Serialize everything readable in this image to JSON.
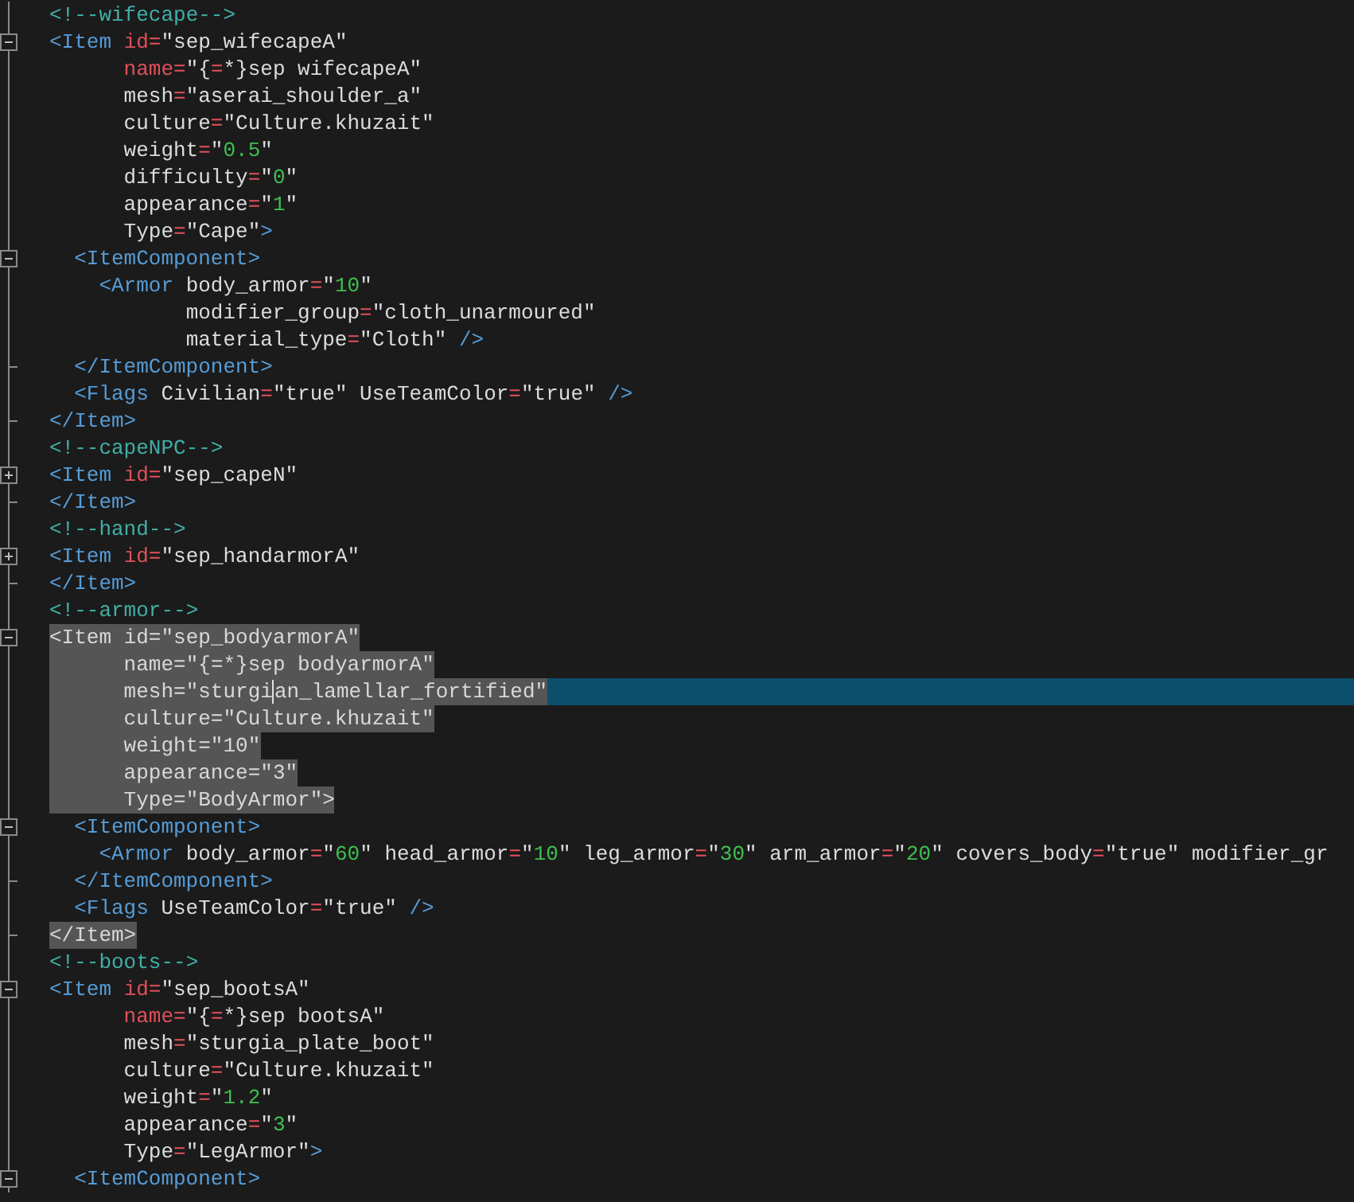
{
  "editor": {
    "lines": [
      {
        "kind": "top",
        "selected": false,
        "tokens": [
          {
            "kind": "comment",
            "text": "<!--wifecape-->"
          }
        ]
      },
      {
        "kind": "top",
        "selected": false,
        "fold_box": {
          "collapsed": false
        },
        "tokens": [
          {
            "kind": "tag",
            "text": "<Item"
          },
          {
            "kind": "attr",
            "text": " id"
          },
          {
            "kind": "eq",
            "text": "="
          },
          {
            "kind": "text",
            "text": "\"sep_wifecapeA\""
          }
        ]
      },
      {
        "kind": "attr",
        "selected": false,
        "tokens": [
          {
            "kind": "attr",
            "text": "name"
          },
          {
            "kind": "eq",
            "text": "="
          },
          {
            "kind": "text",
            "text": "\"{"
          },
          {
            "kind": "eq",
            "text": "="
          },
          {
            "kind": "text",
            "text": "*}sep wifecapeA\""
          }
        ]
      },
      {
        "kind": "attr",
        "selected": false,
        "tokens": [
          {
            "kind": "text",
            "text": "mesh"
          },
          {
            "kind": "eq",
            "text": "="
          },
          {
            "kind": "text",
            "text": "\"aserai_shoulder_a\""
          }
        ]
      },
      {
        "kind": "attr",
        "selected": false,
        "tokens": [
          {
            "kind": "text",
            "text": "culture"
          },
          {
            "kind": "eq",
            "text": "="
          },
          {
            "kind": "text",
            "text": "\"Culture.khuzait\""
          }
        ]
      },
      {
        "kind": "attr",
        "selected": false,
        "tokens": [
          {
            "kind": "text",
            "text": "weight"
          },
          {
            "kind": "eq",
            "text": "="
          },
          {
            "kind": "text",
            "text": "\""
          },
          {
            "kind": "num",
            "text": "0.5"
          },
          {
            "kind": "text",
            "text": "\""
          }
        ]
      },
      {
        "kind": "attr",
        "selected": false,
        "tokens": [
          {
            "kind": "text",
            "text": "difficulty"
          },
          {
            "kind": "eq",
            "text": "="
          },
          {
            "kind": "text",
            "text": "\""
          },
          {
            "kind": "num",
            "text": "0"
          },
          {
            "kind": "text",
            "text": "\""
          }
        ]
      },
      {
        "kind": "attr",
        "selected": false,
        "tokens": [
          {
            "kind": "text",
            "text": "appearance"
          },
          {
            "kind": "eq",
            "text": "="
          },
          {
            "kind": "text",
            "text": "\""
          },
          {
            "kind": "num",
            "text": "1"
          },
          {
            "kind": "text",
            "text": "\""
          }
        ]
      },
      {
        "kind": "attr",
        "selected": false,
        "tokens": [
          {
            "kind": "text",
            "text": "Type"
          },
          {
            "kind": "eq",
            "text": "="
          },
          {
            "kind": "text",
            "text": "\"Cape\""
          },
          {
            "kind": "tag",
            "text": ">"
          }
        ]
      },
      {
        "kind": "child",
        "selected": false,
        "fold_box": {
          "collapsed": false
        },
        "tokens": [
          {
            "kind": "tag",
            "text": "<ItemComponent>"
          }
        ]
      },
      {
        "kind": "grandchild",
        "selected": false,
        "tokens": [
          {
            "kind": "tag",
            "text": "<Armor"
          },
          {
            "kind": "text",
            "text": " body_armor"
          },
          {
            "kind": "eq",
            "text": "="
          },
          {
            "kind": "text",
            "text": "\""
          },
          {
            "kind": "num",
            "text": "10"
          },
          {
            "kind": "text",
            "text": "\""
          }
        ]
      },
      {
        "kind": "attr2",
        "selected": false,
        "tokens": [
          {
            "kind": "text",
            "text": "modifier_group"
          },
          {
            "kind": "eq",
            "text": "="
          },
          {
            "kind": "text",
            "text": "\"cloth_unarmoured\""
          }
        ]
      },
      {
        "kind": "attr2",
        "selected": false,
        "tokens": [
          {
            "kind": "text",
            "text": "material_type"
          },
          {
            "kind": "eq",
            "text": "="
          },
          {
            "kind": "text",
            "text": "\"Cloth\""
          },
          {
            "kind": "tag",
            "text": " />"
          }
        ]
      },
      {
        "kind": "child",
        "selected": false,
        "block_end": true,
        "tokens": [
          {
            "kind": "tag",
            "text": "</ItemComponent>"
          }
        ]
      },
      {
        "kind": "child",
        "selected": false,
        "tokens": [
          {
            "kind": "tag",
            "text": "<Flags"
          },
          {
            "kind": "text",
            "text": " Civilian"
          },
          {
            "kind": "eq",
            "text": "="
          },
          {
            "kind": "text",
            "text": "\"true\""
          },
          {
            "kind": "text",
            "text": " UseTeamColor"
          },
          {
            "kind": "eq",
            "text": "="
          },
          {
            "kind": "text",
            "text": "\"true\""
          },
          {
            "kind": "tag",
            "text": " />"
          }
        ]
      },
      {
        "kind": "top",
        "selected": false,
        "block_end": true,
        "tokens": [
          {
            "kind": "tag",
            "text": "</Item>"
          }
        ]
      },
      {
        "kind": "top",
        "selected": false,
        "tokens": [
          {
            "kind": "comment",
            "text": "<!--capeNPC-->"
          }
        ]
      },
      {
        "kind": "top",
        "selected": false,
        "fold_box": {
          "collapsed": true
        },
        "tokens": [
          {
            "kind": "tag",
            "text": "<Item"
          },
          {
            "kind": "attr",
            "text": " id"
          },
          {
            "kind": "eq",
            "text": "="
          },
          {
            "kind": "text",
            "text": "\"sep_capeN\""
          }
        ]
      },
      {
        "kind": "top",
        "selected": false,
        "block_end": true,
        "tokens": [
          {
            "kind": "tag",
            "text": "</Item>"
          }
        ]
      },
      {
        "kind": "top",
        "selected": false,
        "tokens": [
          {
            "kind": "comment",
            "text": "<!--hand-->"
          }
        ]
      },
      {
        "kind": "top",
        "selected": false,
        "fold_box": {
          "collapsed": true
        },
        "tokens": [
          {
            "kind": "tag",
            "text": "<Item"
          },
          {
            "kind": "attr",
            "text": " id"
          },
          {
            "kind": "eq",
            "text": "="
          },
          {
            "kind": "text",
            "text": "\"sep_handarmorA\""
          }
        ]
      },
      {
        "kind": "top",
        "selected": false,
        "block_end": true,
        "tokens": [
          {
            "kind": "tag",
            "text": "</Item>"
          }
        ]
      },
      {
        "kind": "top",
        "selected": false,
        "tokens": [
          {
            "kind": "comment",
            "text": "<!--armor-->"
          }
        ]
      },
      {
        "kind": "top",
        "selected": true,
        "fold_box": {
          "collapsed": false
        },
        "tokens": [
          {
            "kind": "tag",
            "text": "<Item"
          },
          {
            "kind": "attr",
            "text": " id"
          },
          {
            "kind": "eq",
            "text": "="
          },
          {
            "kind": "text",
            "text": "\"sep_bodyarmorA\""
          }
        ]
      },
      {
        "kind": "attr",
        "selected": true,
        "tokens": [
          {
            "kind": "attr",
            "text": "name"
          },
          {
            "kind": "eq",
            "text": "="
          },
          {
            "kind": "text",
            "text": "\"{"
          },
          {
            "kind": "eq",
            "text": "="
          },
          {
            "kind": "text",
            "text": "*}sep bodyarmorA\""
          }
        ]
      },
      {
        "kind": "attr",
        "selected": true,
        "current": true,
        "tokens": [
          {
            "kind": "text",
            "text": "mesh"
          },
          {
            "kind": "eq",
            "text": "="
          },
          {
            "kind": "text",
            "text": "\"sturgi"
          },
          {
            "kind": "text",
            "text": "an_lamellar_fortified\"",
            "caret": true
          }
        ]
      },
      {
        "kind": "attr",
        "selected": true,
        "tokens": [
          {
            "kind": "text",
            "text": "culture"
          },
          {
            "kind": "eq",
            "text": "="
          },
          {
            "kind": "text",
            "text": "\"Culture.khuzait\""
          }
        ]
      },
      {
        "kind": "attr",
        "selected": true,
        "tokens": [
          {
            "kind": "text",
            "text": "weight"
          },
          {
            "kind": "eq",
            "text": "="
          },
          {
            "kind": "text",
            "text": "\""
          },
          {
            "kind": "num",
            "text": "10"
          },
          {
            "kind": "text",
            "text": "\""
          }
        ]
      },
      {
        "kind": "attr",
        "selected": true,
        "tokens": [
          {
            "kind": "text",
            "text": "appearance"
          },
          {
            "kind": "eq",
            "text": "="
          },
          {
            "kind": "text",
            "text": "\""
          },
          {
            "kind": "num",
            "text": "3"
          },
          {
            "kind": "text",
            "text": "\""
          }
        ]
      },
      {
        "kind": "attr",
        "selected": true,
        "tokens": [
          {
            "kind": "text",
            "text": "Type"
          },
          {
            "kind": "eq",
            "text": "="
          },
          {
            "kind": "text",
            "text": "\"BodyArmor\""
          },
          {
            "kind": "tag",
            "text": ">"
          }
        ]
      },
      {
        "kind": "child",
        "selected": false,
        "fold_box": {
          "collapsed": false
        },
        "tokens": [
          {
            "kind": "tag",
            "text": "<ItemComponent>"
          }
        ]
      },
      {
        "kind": "grandchild",
        "selected": false,
        "tokens": [
          {
            "kind": "tag",
            "text": "<Armor"
          },
          {
            "kind": "text",
            "text": " body_armor"
          },
          {
            "kind": "eq",
            "text": "="
          },
          {
            "kind": "text",
            "text": "\""
          },
          {
            "kind": "num",
            "text": "60"
          },
          {
            "kind": "text",
            "text": "\""
          },
          {
            "kind": "text",
            "text": " head_armor"
          },
          {
            "kind": "eq",
            "text": "="
          },
          {
            "kind": "text",
            "text": "\""
          },
          {
            "kind": "num",
            "text": "10"
          },
          {
            "kind": "text",
            "text": "\""
          },
          {
            "kind": "text",
            "text": " leg_armor"
          },
          {
            "kind": "eq",
            "text": "="
          },
          {
            "kind": "text",
            "text": "\""
          },
          {
            "kind": "num",
            "text": "30"
          },
          {
            "kind": "text",
            "text": "\""
          },
          {
            "kind": "text",
            "text": " arm_armor"
          },
          {
            "kind": "eq",
            "text": "="
          },
          {
            "kind": "text",
            "text": "\""
          },
          {
            "kind": "num",
            "text": "20"
          },
          {
            "kind": "text",
            "text": "\""
          },
          {
            "kind": "text",
            "text": " covers_body"
          },
          {
            "kind": "eq",
            "text": "="
          },
          {
            "kind": "text",
            "text": "\"true\""
          },
          {
            "kind": "text",
            "text": " modifier_gr"
          }
        ]
      },
      {
        "kind": "child",
        "selected": false,
        "block_end": true,
        "tokens": [
          {
            "kind": "tag",
            "text": "</ItemComponent>"
          }
        ]
      },
      {
        "kind": "child",
        "selected": false,
        "tokens": [
          {
            "kind": "tag",
            "text": "<Flags"
          },
          {
            "kind": "text",
            "text": " UseTeamColor"
          },
          {
            "kind": "eq",
            "text": "="
          },
          {
            "kind": "text",
            "text": "\"true\""
          },
          {
            "kind": "tag",
            "text": " />"
          }
        ]
      },
      {
        "kind": "top",
        "selected": true,
        "block_end": true,
        "tokens": [
          {
            "kind": "tag",
            "text": "</Item>"
          }
        ]
      },
      {
        "kind": "top",
        "selected": false,
        "tokens": [
          {
            "kind": "comment",
            "text": "<!--boots-->"
          }
        ]
      },
      {
        "kind": "top",
        "selected": false,
        "fold_box": {
          "collapsed": false
        },
        "tokens": [
          {
            "kind": "tag",
            "text": "<Item"
          },
          {
            "kind": "attr",
            "text": " id"
          },
          {
            "kind": "eq",
            "text": "="
          },
          {
            "kind": "text",
            "text": "\"sep_bootsA\""
          }
        ]
      },
      {
        "kind": "attr",
        "selected": false,
        "tokens": [
          {
            "kind": "attr",
            "text": "name"
          },
          {
            "kind": "eq",
            "text": "="
          },
          {
            "kind": "text",
            "text": "\"{"
          },
          {
            "kind": "eq",
            "text": "="
          },
          {
            "kind": "text",
            "text": "*}sep bootsA\""
          }
        ]
      },
      {
        "kind": "attr",
        "selected": false,
        "tokens": [
          {
            "kind": "text",
            "text": "mesh"
          },
          {
            "kind": "eq",
            "text": "="
          },
          {
            "kind": "text",
            "text": "\"sturgia_plate_boot\""
          }
        ]
      },
      {
        "kind": "attr",
        "selected": false,
        "tokens": [
          {
            "kind": "text",
            "text": "culture"
          },
          {
            "kind": "eq",
            "text": "="
          },
          {
            "kind": "text",
            "text": "\"Culture.khuzait\""
          }
        ]
      },
      {
        "kind": "attr",
        "selected": false,
        "tokens": [
          {
            "kind": "text",
            "text": "weight"
          },
          {
            "kind": "eq",
            "text": "="
          },
          {
            "kind": "text",
            "text": "\""
          },
          {
            "kind": "num",
            "text": "1.2"
          },
          {
            "kind": "text",
            "text": "\""
          }
        ]
      },
      {
        "kind": "attr",
        "selected": false,
        "tokens": [
          {
            "kind": "text",
            "text": "appearance"
          },
          {
            "kind": "eq",
            "text": "="
          },
          {
            "kind": "text",
            "text": "\""
          },
          {
            "kind": "num",
            "text": "3"
          },
          {
            "kind": "text",
            "text": "\""
          }
        ]
      },
      {
        "kind": "attr",
        "selected": false,
        "tokens": [
          {
            "kind": "text",
            "text": "Type"
          },
          {
            "kind": "eq",
            "text": "="
          },
          {
            "kind": "text",
            "text": "\"LegArmor\""
          },
          {
            "kind": "tag",
            "text": ">"
          }
        ]
      },
      {
        "kind": "child",
        "selected": false,
        "fold_box": {
          "collapsed": false
        },
        "tokens": [
          {
            "kind": "tag",
            "text": "<ItemComponent>"
          }
        ]
      }
    ]
  }
}
